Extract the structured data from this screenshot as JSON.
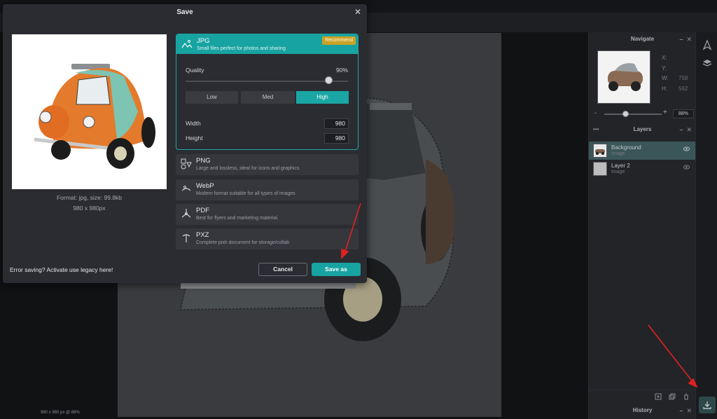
{
  "dialog": {
    "title": "Save",
    "preview": {
      "format_line": "Format: jpg, size: 99.8kb",
      "dims_line": "980 x 980px"
    },
    "formats": [
      {
        "name": "JPG",
        "desc": "Small files perfect for photos and sharing",
        "badge": "Recommend",
        "selected": true,
        "icon": "jpg-image-icon"
      },
      {
        "name": "PNG",
        "desc": "Large and lossless, ideal for icons and graphics",
        "icon": "png-shapes-icon"
      },
      {
        "name": "WebP",
        "desc": "Modern format suitable for all types of images",
        "icon": "webp-image-icon"
      },
      {
        "name": "PDF",
        "desc": "Best for flyers and marketing material.",
        "icon": "pdf-acrobat-icon"
      },
      {
        "name": "PXZ",
        "desc": "Complete pixlr document for storage/collab",
        "icon": "pxz-pixlr-icon"
      }
    ],
    "jpg_options": {
      "quality_label": "Quality",
      "quality_value": "90%",
      "quality_fraction": 0.9,
      "presets": [
        "Low",
        "Med",
        "High"
      ],
      "active_preset": "High",
      "width_label": "Width",
      "width_value": "980",
      "height_label": "Height",
      "height_value": "980"
    },
    "error_text": "Error saving? Activate use legacy here!",
    "cancel_label": "Cancel",
    "save_label": "Save as"
  },
  "navigate": {
    "title": "Navigate",
    "x_label": "X:",
    "y_label": "Y:",
    "w_label": "W:",
    "w_value": "758",
    "h_label": "H:",
    "h_value": "562",
    "zoom": "88%"
  },
  "layers": {
    "title": "Layers",
    "items": [
      {
        "name": "Background",
        "sub": "Image",
        "active": true
      },
      {
        "name": "Layer 2",
        "sub": "Image",
        "active": false
      }
    ]
  },
  "history": {
    "title": "History"
  },
  "status_text": "980 x 980 px @ 88%",
  "colors": {
    "accent": "#17a3a1",
    "badge": "#c9a227",
    "annotation": "#e02020"
  }
}
